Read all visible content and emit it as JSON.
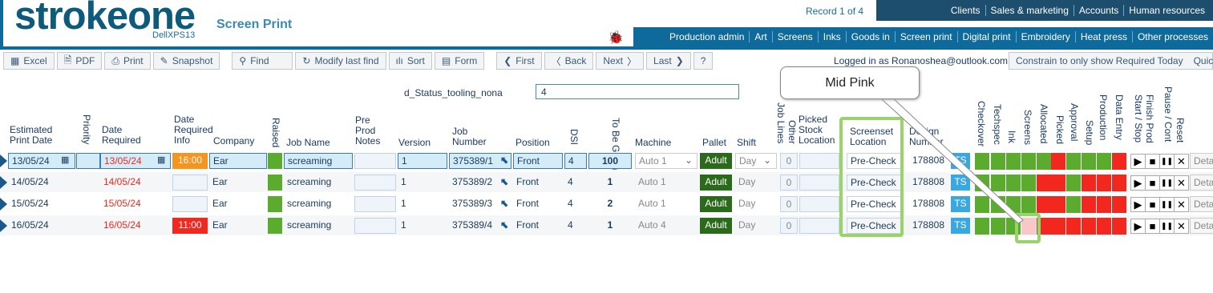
{
  "app": {
    "logo": "strokeone",
    "host": "DellXPS13",
    "page_title": "Screen Print",
    "record": "Record 1 of 4"
  },
  "top_menu": [
    "Clients",
    "Sales & marketing",
    "Accounts",
    "Human resources"
  ],
  "process_menu": [
    "Production admin",
    "Art",
    "Screens",
    "Inks",
    "Goods in",
    "Screen print",
    "Digital print",
    "Embroidery",
    "Heat press",
    "Other processes"
  ],
  "toolbar": {
    "excel": "Excel",
    "pdf": "PDF",
    "print": "Print",
    "snapshot": "Snapshot",
    "find": "Find",
    "modify": "Modify last find",
    "sort": "Sort",
    "form": "Form",
    "first": "First",
    "back": "Back",
    "next": "Next",
    "last": "Last",
    "help": "?"
  },
  "login": "Logged in as Ronanoshea@outlook.com",
  "constrain": "Constrain to only show Required Today",
  "quick": "Quick",
  "status": {
    "label": "d_Status_tooling_nona",
    "value": "4"
  },
  "tooltip": "Mid Pink",
  "headers": {
    "est": "Estimated Print Date",
    "priority": "Priority",
    "date_req": "Date Required",
    "date_req_info": "Date Required Info",
    "company": "Company",
    "raised": "Raised",
    "job_name": "Job Name",
    "pre_prod": "Pre Prod Notes",
    "version": "Version",
    "job_number": "Job Number",
    "position": "Position",
    "dsi": "DSI",
    "to_be_given": "To Be Given",
    "machine": "Machine",
    "pallet": "Pallet",
    "shift": "Shift",
    "job_lines": "Job Lines",
    "other": "Other",
    "picked_stock": "Picked Stock Location",
    "screenset": "Screenset Location",
    "design_number": "Design Number",
    "checkover": "Checkover",
    "techspec": "Techspec",
    "ink": "Ink",
    "screens": "Screens",
    "allocated": "Allocated",
    "picked": "Picked",
    "approval": "Approval",
    "setup": "Setup",
    "production": "Production",
    "data_entry": "Data Entry",
    "start_stop": "Start / Stop",
    "finish_prod": "Finish Prod",
    "pause_cont": "Pause / Cont",
    "reset": "Reset"
  },
  "rows": [
    {
      "est": "13/05/24",
      "date_req": "13/05/24",
      "info": "16:00",
      "info_color": "#f7941d",
      "company": "Ear",
      "job_name": "screaming",
      "version": "1",
      "job_number": "375389/1",
      "position": "Front",
      "dsi": "4",
      "to_be_given": "100",
      "machine": "Auto 1",
      "pallet": "Adult",
      "shift": "Day",
      "lines": "0",
      "screenset": "Pre-Check",
      "design": "178808",
      "ts": "TS",
      "detail": "Details",
      "status": [
        "g",
        "g",
        "g",
        "g",
        "g",
        "r",
        "g",
        "g",
        "g",
        "r"
      ]
    },
    {
      "est": "14/05/24",
      "date_req": "14/05/24",
      "info": "",
      "info_color": "",
      "company": "Ear",
      "job_name": "screaming",
      "version": "1",
      "job_number": "375389/2",
      "position": "Front",
      "dsi": "4",
      "to_be_given": "1",
      "machine": "Auto 1",
      "pallet": "Adult",
      "shift": "Day",
      "lines": "0",
      "screenset": "Pre-Check",
      "design": "178808",
      "ts": "TS",
      "detail": "Details",
      "status": [
        "g",
        "g",
        "g",
        "g",
        "r",
        "r",
        "g",
        "r",
        "r",
        "r"
      ]
    },
    {
      "est": "15/05/24",
      "date_req": "15/05/24",
      "info": "",
      "info_color": "",
      "company": "Ear",
      "job_name": "screaming",
      "version": "1",
      "job_number": "375389/3",
      "position": "Front",
      "dsi": "4",
      "to_be_given": "2",
      "machine": "Auto 1",
      "pallet": "Adult",
      "shift": "Day",
      "lines": "0",
      "screenset": "Pre-Check",
      "design": "178808",
      "ts": "TS",
      "detail": "Details",
      "status": [
        "g",
        "g",
        "g",
        "g",
        "r",
        "r",
        "g",
        "r",
        "r",
        "r"
      ]
    },
    {
      "est": "16/05/24",
      "date_req": "16/05/24",
      "info": "11:00",
      "info_color": "#f2281e",
      "company": "Ear",
      "job_name": "screaming",
      "version": "1",
      "job_number": "375389/4",
      "position": "Front",
      "dsi": "4",
      "to_be_given": "1",
      "machine": "Auto 4",
      "pallet": "Adult",
      "shift": "Day",
      "lines": "0",
      "screenset": "Pre-Check",
      "design": "178808",
      "ts": "TS",
      "detail": "Details",
      "status": [
        "g",
        "g",
        "g",
        "p",
        "r",
        "r",
        "r",
        "r",
        "r",
        "r"
      ]
    }
  ],
  "status_colors": {
    "g": "#5aab2e",
    "r": "#f2281e",
    "p": "#f8c8c8"
  }
}
